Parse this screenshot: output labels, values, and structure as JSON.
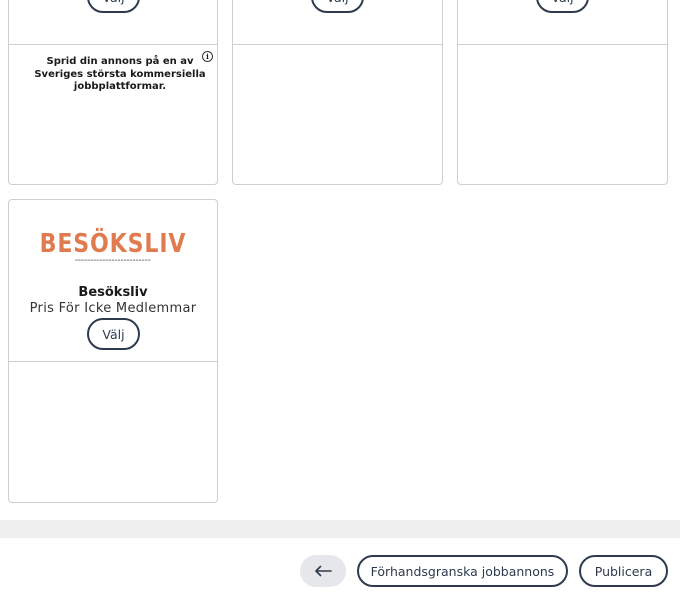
{
  "cards": [
    {
      "button_label": "Välj",
      "description": "Sprid din annons på en av Sveriges största kommersiella jobbplattformar."
    },
    {
      "button_label": "Välj"
    },
    {
      "button_label": "Välj"
    },
    {
      "logo_text": "BESÖKSLIV",
      "title": "Besöksliv",
      "subtitle": "Pris För Icke Medlemmar",
      "button_label": "Välj"
    }
  ],
  "footer": {
    "back_icon": "arrow-left-icon",
    "preview_label": "Förhandsgranska jobbannons",
    "publish_label": "Publicera"
  },
  "colors": {
    "accent": "#2e3b4e",
    "logo": "#e07b4f",
    "border": "#cfcfcf",
    "footer_band": "#efefef"
  }
}
